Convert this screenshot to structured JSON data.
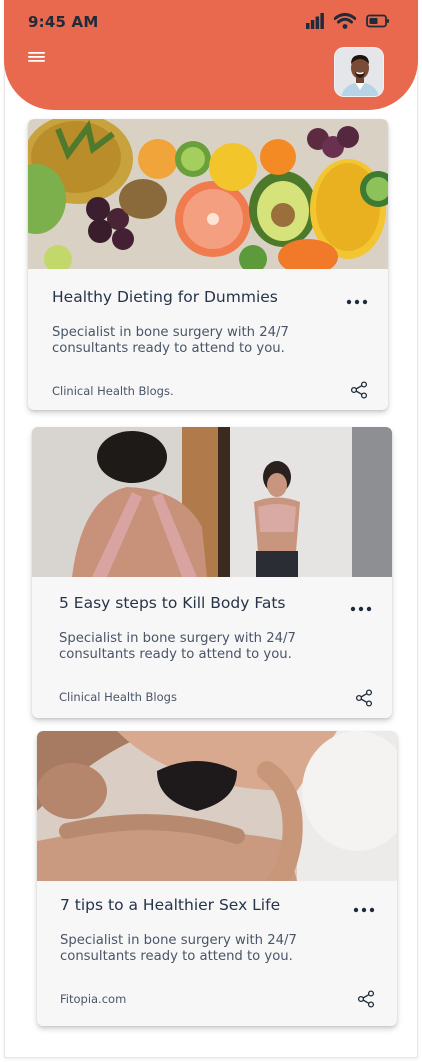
{
  "status_bar": {
    "time": "9:45 AM"
  },
  "header": {
    "menu_icon": "hamburger-menu-icon",
    "avatar_icon": "user-avatar"
  },
  "colors": {
    "accent": "#e8694d",
    "text": "#243247",
    "card": "#f7f7f7"
  },
  "cards": [
    {
      "title": "Healthy Dieting for Dummies",
      "description": "Specialist in bone surgery with 24/7 consultants ready to attend to you.",
      "source": "Clinical Health Blogs.",
      "image": "fruits-image"
    },
    {
      "title": "5 Easy steps to Kill Body Fats",
      "description": "Specialist in bone surgery with 24/7 consultants ready to attend to you.",
      "source": "Clinical Health Blogs",
      "image": "mirror-fitness-image"
    },
    {
      "title": "7 tips to a Healthier Sex Life",
      "description": "Specialist in bone surgery with 24/7 consultants ready to attend to you.",
      "source": "Fitopia.com",
      "image": "couple-image"
    }
  ]
}
